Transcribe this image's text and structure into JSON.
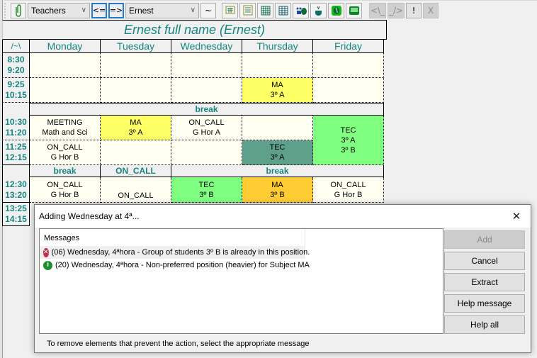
{
  "toolbar": {
    "clip_icon": "paperclip-icon",
    "view_select": "Teachers",
    "prev_label": "<=",
    "next_label": "=>",
    "entity_select": "Ernest",
    "tilde_label": "~",
    "icons": [
      "grid-view-1-icon",
      "grid-view-2-icon",
      "grid-view-3-icon",
      "grid-view-4-icon",
      "people-icon",
      "coffee-icon",
      "hand-icon",
      "card-icon"
    ],
    "undo_label": "<\\_",
    "redo_label": "_/>",
    "warn_label": "!",
    "x_label": "X"
  },
  "timetable": {
    "title": "Ernest full name (Ernest)",
    "corner": "/~\\",
    "days": [
      "Monday",
      "Tuesday",
      "Wednesday",
      "Thursday",
      "Friday"
    ],
    "rows": [
      {
        "start": "8:30",
        "end": "9:20",
        "cells": [
          {
            "l1": "",
            "l2": ""
          },
          {
            "l1": "",
            "l2": ""
          },
          {
            "l1": "",
            "l2": ""
          },
          {
            "l1": "",
            "l2": ""
          },
          {
            "l1": "",
            "l2": ""
          }
        ]
      },
      {
        "start": "9:25",
        "end": "10:15",
        "cells": [
          {
            "l1": "",
            "l2": ""
          },
          {
            "l1": "",
            "l2": ""
          },
          {
            "l1": "",
            "l2": ""
          },
          {
            "l1": "MA",
            "l2": "3º A",
            "color": "yellow"
          },
          {
            "l1": "",
            "l2": ""
          }
        ]
      },
      {
        "break": "break"
      },
      {
        "start": "10:30",
        "end": "11:20",
        "cells": [
          {
            "l1": "MEETING",
            "l2": "Math and Sci"
          },
          {
            "l1": "MA",
            "l2": "3º A",
            "color": "yellow"
          },
          {
            "l1": "ON_CALL",
            "l2": "G Hor A"
          },
          {
            "l1": "",
            "l2": ""
          },
          {
            "l1": "TEC",
            "l2": "3º A",
            "l3": "3º B",
            "color": "green"
          }
        ]
      },
      {
        "start": "11:25",
        "end": "12:15",
        "cells": [
          {
            "l1": "ON_CALL",
            "l2": "G Hor B"
          },
          {
            "l1": "",
            "l2": ""
          },
          {
            "l1": "",
            "l2": ""
          },
          {
            "l1": "TEC",
            "l2": "3º A",
            "color": "dkgreen"
          }
        ]
      },
      {
        "breaks": [
          "break",
          "ON_CALL",
          "break"
        ]
      },
      {
        "start": "12:30",
        "end": "13:20",
        "cells": [
          {
            "l1": "ON_CALL",
            "l2": "G Hor B"
          },
          {
            "l1": "ON_CALL",
            "l2": ""
          },
          {
            "l1": "TEC",
            "l2": "3º B",
            "color": "green"
          },
          {
            "l1": "MA",
            "l2": "3º B",
            "color": "orange"
          },
          {
            "l1": "ON_CALL",
            "l2": "G Hor B"
          }
        ]
      },
      {
        "start": "13:25",
        "end": "14:15"
      }
    ]
  },
  "dialog": {
    "title": "Adding Wednesday at 4ª...",
    "close_icon": "close-icon",
    "messages_header": "Messages",
    "messages": [
      {
        "type": "error",
        "icon": "error-icon",
        "text": "(06) Wednesday, 4ªhora - Group of students 3º B is already in this position."
      },
      {
        "type": "info",
        "icon": "info-icon",
        "text": "(20) Wednesday, 4ªhora - Non-preferred position (heavier) for Subject MA"
      }
    ],
    "buttons": {
      "add": "Add",
      "cancel": "Cancel",
      "extract": "Extract",
      "help_message": "Help message",
      "help_all": "Help all"
    },
    "footer": "To remove elements that prevent the action, select the appropriate message"
  }
}
